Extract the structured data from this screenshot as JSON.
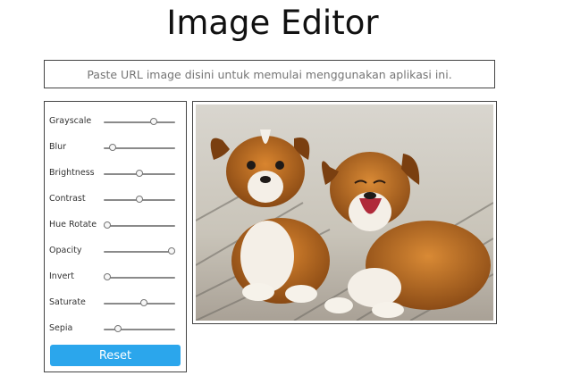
{
  "app": {
    "title": "Image Editor"
  },
  "url_input": {
    "placeholder": "Paste URL image disini untuk memulai menggunakan aplikasi ini.",
    "value": ""
  },
  "filters": [
    {
      "label": "Grayscale",
      "level": 0.7
    },
    {
      "label": "Blur",
      "level": 0.12
    },
    {
      "label": "Brightness",
      "level": 0.5
    },
    {
      "label": "Contrast",
      "level": 0.5
    },
    {
      "label": "Hue Rotate",
      "level": 0.05
    },
    {
      "label": "Opacity",
      "level": 0.95
    },
    {
      "label": "Invert",
      "level": 0.05
    },
    {
      "label": "Saturate",
      "level": 0.56
    },
    {
      "label": "Sepia",
      "level": 0.2
    }
  ],
  "reset_label": "Reset",
  "colors": {
    "accent": "#2ba6ec",
    "border": "#444444"
  },
  "image": {
    "description_icon": "two-puppies-photo"
  }
}
